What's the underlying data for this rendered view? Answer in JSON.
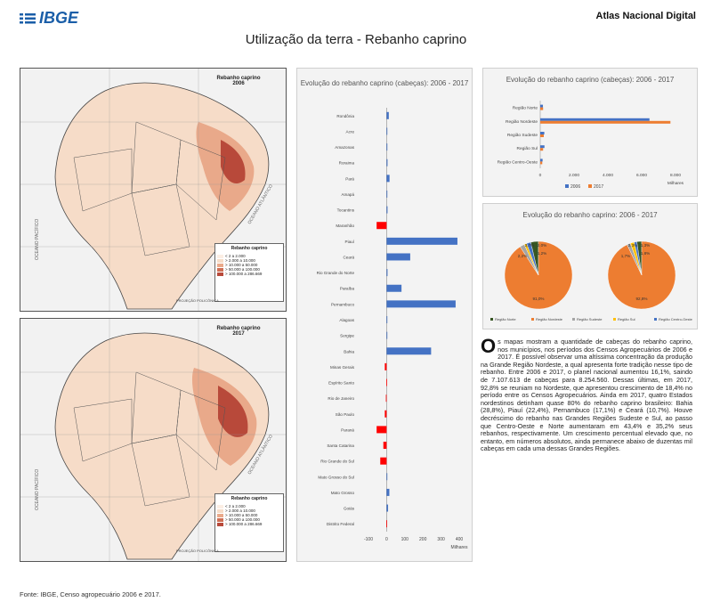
{
  "header": {
    "logo_text": "IBGE",
    "atlas_title": "Atlas Nacional Digital",
    "page_title": "Utilização da terra - Rebanho caprino"
  },
  "maps": [
    {
      "title": "Rebanho caprino",
      "year": "2006",
      "legend_title": "Rebanho caprino",
      "legend_items": [
        "< 2 a 2.000",
        "> 2.000 a 10.000",
        "> 10.000 a 50.000",
        "> 50.000 a 100.000",
        "> 100.000 a 286.669"
      ],
      "projection": "PROJEÇÃO POLICÔNICA",
      "ocean_left": "OCEANO PACÍFICO",
      "ocean_right": "OCEANO ATLÂNTICO"
    },
    {
      "title": "Rebanho caprino",
      "year": "2017",
      "legend_title": "Rebanho caprino",
      "legend_items": [
        "< 2 a 2.000",
        "> 2.000 a 10.000",
        "> 10.000 a 50.000",
        "> 50.000 a 100.000",
        "> 100.000 a 286.669"
      ],
      "projection": "PROJEÇÃO POLICÔNICA",
      "ocean_left": "OCEANO PACÍFICO",
      "ocean_right": "OCEANO ATLÂNTICO"
    }
  ],
  "colors": {
    "blue": "#4472c4",
    "orange": "#ed7d31",
    "red": "#ff0000",
    "gray": "#a5a5a5",
    "yellow": "#ffc000",
    "dark_green": "#375623",
    "map_light": "#f6dcc8",
    "map_mid": "#e9a98a",
    "map_dark": "#b8493a"
  },
  "chart_data": [
    {
      "type": "bar",
      "orientation": "horizontal",
      "title": "Evolução do rebanho caprino (cabeças): 2006 - 2017",
      "xlabel": "Milhares",
      "xlim": [
        -100,
        400
      ],
      "xticks": [
        "-100",
        "0",
        "100",
        "200",
        "300",
        "400"
      ],
      "categories": [
        "Rondônia",
        "Acre",
        "Amazonas",
        "Roraima",
        "Pará",
        "Amapá",
        "Tocantins",
        "Maranhão",
        "Piauí",
        "Ceará",
        "Rio Grande do Norte",
        "Paraíba",
        "Pernambuco",
        "Alagoas",
        "Sergipe",
        "Bahia",
        "Minas Gerais",
        "Espírito Santo",
        "Rio de Janeiro",
        "São Paulo",
        "Paraná",
        "Santa Catarina",
        "Rio Grande do Sul",
        "Mato Grosso do Sul",
        "Mato Grosso",
        "Goiás",
        "Distrito Federal"
      ],
      "values": [
        12,
        2,
        4,
        5,
        16,
        1,
        5,
        -55,
        390,
        130,
        5,
        82,
        380,
        3,
        3,
        245,
        -10,
        -2,
        -4,
        -10,
        -55,
        -18,
        -35,
        2,
        15,
        8,
        -1
      ]
    },
    {
      "type": "bar",
      "orientation": "horizontal",
      "title": "Evolução do rebanho caprino (cabeças): 2006 - 2017",
      "xlabel": "Milhares",
      "xlim": [
        0,
        8000
      ],
      "xticks": [
        "0",
        "2.000",
        "4.000",
        "6.000",
        "8.000"
      ],
      "categories": [
        "Região Norte",
        "Região Nordeste",
        "Região Sudeste",
        "Região Sul",
        "Região Centro-Oeste"
      ],
      "series": [
        {
          "name": "2006",
          "values": [
            160,
            6460,
            240,
            250,
            140
          ]
        },
        {
          "name": "2017",
          "values": [
            170,
            7700,
            210,
            170,
            120
          ]
        }
      ]
    },
    {
      "type": "pie",
      "title": "Evolução do rebanho caprino: 2006 - 2017",
      "legend": [
        "Região Norte",
        "Região Nordeste",
        "Região Sudeste",
        "Região Sul",
        "Região Centro-Oeste"
      ],
      "pies": [
        {
          "labels": [
            "3,7%",
            "91,0%",
            "2,2%",
            "1,2%",
            "2,0%"
          ],
          "values": [
            3.7,
            91.0,
            2.2,
            1.2,
            2.0
          ]
        },
        {
          "labels": [
            "2,3%",
            "92,8%",
            "1,7%",
            "1,8%",
            "1,3%"
          ],
          "values": [
            2.3,
            92.8,
            1.7,
            1.8,
            1.3
          ]
        }
      ]
    }
  ],
  "description": {
    "dropcap": "O",
    "text": "s mapas mostram a quantidade de cabeças do rebanho caprino, nos municípios, nos períodos dos Censos Agropecuários de 2006 e 2017. É possível observar uma altíssima concentração da produção na Grande Região Nordeste, a qual apresenta forte tradição nesse tipo de rebanho. Entre 2006 e 2017, o planel nacional aumentou 16,1%, saindo de 7.107.613 de cabeças para 8.254.560. Dessas últimas, em 2017, 92,8% se reuniam no Nordeste, que apresentou crescimento de 18,4% no período entre os Censos Agropecuários. Ainda em 2017, quatro Estados nordestinos detinham quase 80% do rebanho caprino brasileiro: Bahia (28,8%), Piauí (22,4%), Pernambuco (17,1%) e Ceará (10,7%). Houve decréscimo do rebanho nas Grandes Regiões Sudeste e Sul, ao passo que Centro-Oeste e Norte aumentaram em 43,4% e 35,2% seus rebanhos, respectivamente. Um crescimento percentual elevado que, no entanto, em números absolutos, ainda permanece abaixo de duzentas mil cabeças em cada uma dessas Grandes Regiões."
  },
  "footer": {
    "source": "Fonte: IBGE, Censo agropecuário 2006 e 2017."
  }
}
